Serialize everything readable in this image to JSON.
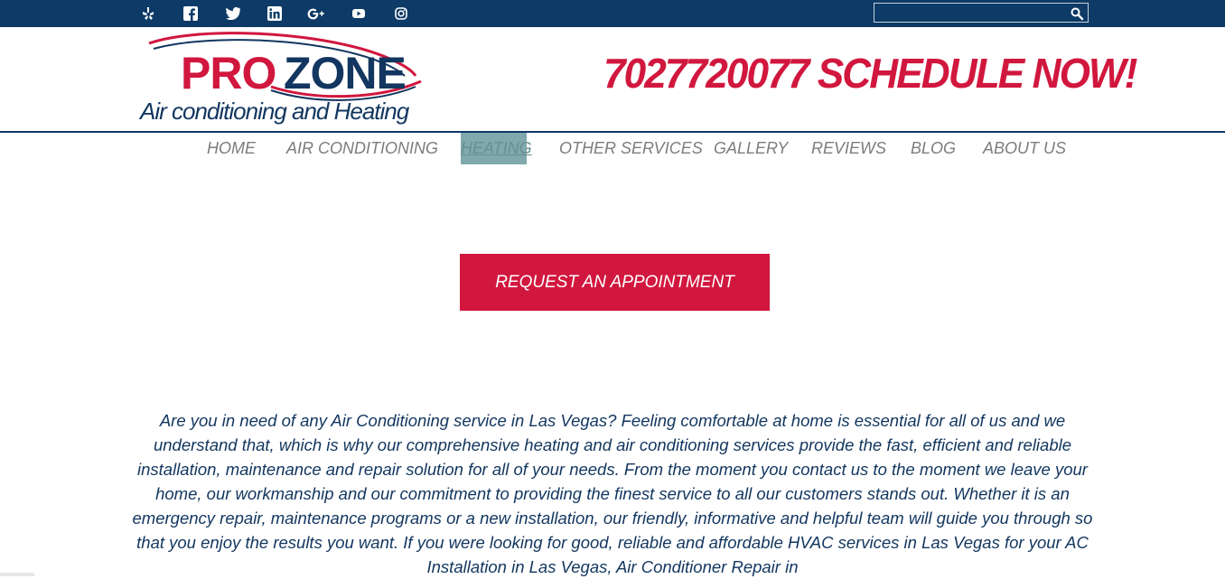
{
  "social": {
    "icons": [
      "yelp-icon",
      "facebook-icon",
      "twitter-icon",
      "linkedin-icon",
      "google-plus-icon",
      "youtube-icon",
      "instagram-icon"
    ]
  },
  "search": {
    "value": "",
    "placeholder": ""
  },
  "logo": {
    "pro": "PRO",
    "zone": "ZONE",
    "tagline": "Air conditioning and Heating"
  },
  "header": {
    "phone_cta": "7027720077 SCHEDULE NOW!"
  },
  "nav": {
    "items": [
      {
        "label": "HOME"
      },
      {
        "label": "AIR CONDITIONING"
      },
      {
        "label": "HEATING"
      },
      {
        "label": "OTHER SERVICES"
      },
      {
        "label": "GALLERY"
      },
      {
        "label": "REVIEWS"
      },
      {
        "label": "BLOG"
      },
      {
        "label": "ABOUT US"
      }
    ],
    "active": "HEATING"
  },
  "cta": {
    "label": "REQUEST AN APPOINTMENT"
  },
  "content": {
    "intro": "Are you in need of any Air Conditioning service in Las Vegas? Feeling comfortable at home is essential for all of us and we understand that, which is why our comprehensive heating and air conditioning services provide the fast, efficient and reliable installation, maintenance and repair solution for all of your needs. From the moment you contact us to the moment we leave your home, our workmanship and our commitment to providing the finest service to all our customers stands out. Whether it is an emergency repair, maintenance programs or a new installation, our friendly, informative and helpful team will guide you through so that you enjoy the results you want. If you were looking for good, reliable and affordable HVAC services in Las Vegas for your AC Installation in Las Vegas, Air Conditioner Repair in"
  },
  "colors": {
    "navy": "#0d3a66",
    "brand_red": "#d1173e",
    "nav_gray": "#7d7d7d",
    "active_highlight": "#7fa9ad",
    "text_navy": "#12365f"
  }
}
